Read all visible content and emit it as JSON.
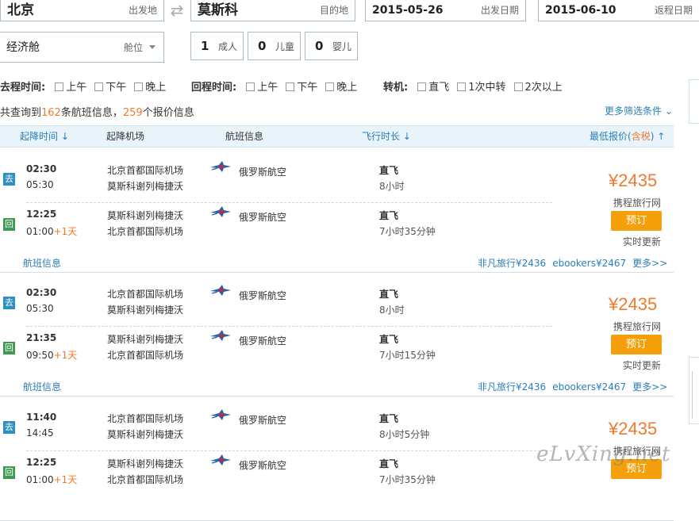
{
  "search": {
    "from_city": "北京",
    "from_hint": "出发地",
    "to_city": "莫斯科",
    "to_hint": "目的地",
    "depart_date": "2015-05-26",
    "depart_hint": "出发日期",
    "return_date": "2015-06-10",
    "return_hint": "返程日期",
    "cabin": "经济舱",
    "cabin_hint": "舱位",
    "adults": "1",
    "adults_label": "成人",
    "children": "0",
    "children_label": "儿童",
    "infants": "0",
    "infants_label": "婴儿"
  },
  "filters": {
    "outbound_label": "去程时间:",
    "outbound_options": [
      "上午",
      "下午",
      "晚上"
    ],
    "return_label": "回程时间:",
    "return_options": [
      "上午",
      "下午",
      "晚上"
    ],
    "transfer_label": "转机:",
    "transfer_options": [
      "直飞",
      "1次中转",
      "2次以上"
    ]
  },
  "summary": {
    "prefix": "共查询到",
    "flights": "162",
    "mid": "条航班信息，",
    "quotes": "259",
    "suffix": "个报价信息",
    "more_filters": "更多筛选条件 ⌄"
  },
  "columns": {
    "time": "起降时间 ↓",
    "airport": "起降机场",
    "flight": "航班信息",
    "duration": "飞行时长 ↓",
    "price_prefix": "最低报价(",
    "price_tax": "含税",
    "price_suffix": ") ↑"
  },
  "results": [
    {
      "legs": [
        {
          "tag": "去",
          "dep": "02:30",
          "arr": "05:30",
          "plus": "",
          "from": "北京首都国际机场",
          "to": "莫斯科谢列梅捷沃",
          "airline": "俄罗斯航空",
          "stop": "直飞",
          "duration": "8小时"
        },
        {
          "tag": "回",
          "dep": "12:25",
          "arr": "01:00",
          "plus": "+1天",
          "from": "莫斯科谢列梅捷沃",
          "to": "北京首都国际机场",
          "airline": "俄罗斯航空",
          "stop": "直飞",
          "duration": "7小时35分钟"
        }
      ],
      "price": "¥2435",
      "vendor": "携程旅行网",
      "book": "预订",
      "realtime": "实时更新",
      "info": "航班信息",
      "others": [
        "非凡旅行¥2436",
        "ebookers¥2467",
        "更多>>"
      ]
    },
    {
      "legs": [
        {
          "tag": "去",
          "dep": "02:30",
          "arr": "05:30",
          "plus": "",
          "from": "北京首都国际机场",
          "to": "莫斯科谢列梅捷沃",
          "airline": "俄罗斯航空",
          "stop": "直飞",
          "duration": "8小时"
        },
        {
          "tag": "回",
          "dep": "21:35",
          "arr": "09:50",
          "plus": "+1天",
          "from": "莫斯科谢列梅捷沃",
          "to": "北京首都国际机场",
          "airline": "俄罗斯航空",
          "stop": "直飞",
          "duration": "7小时15分钟"
        }
      ],
      "price": "¥2435",
      "vendor": "携程旅行网",
      "book": "预订",
      "realtime": "实时更新",
      "info": "航班信息",
      "others": [
        "非凡旅行¥2436",
        "ebookers¥2467",
        "更多>>"
      ]
    },
    {
      "legs": [
        {
          "tag": "去",
          "dep": "11:40",
          "arr": "14:45",
          "plus": "",
          "from": "北京首都国际机场",
          "to": "莫斯科谢列梅捷沃",
          "airline": "俄罗斯航空",
          "stop": "直飞",
          "duration": "8小时5分钟"
        },
        {
          "tag": "回",
          "dep": "12:25",
          "arr": "01:00",
          "plus": "+1天",
          "from": "莫斯科谢列梅捷沃",
          "to": "北京首都国际机场",
          "airline": "俄罗斯航空",
          "stop": "直飞",
          "duration": "7小时35分钟"
        }
      ],
      "price": "¥2435",
      "vendor": "携程旅行网",
      "book": "预订",
      "realtime": "",
      "info": "",
      "others": []
    }
  ],
  "watermark": "eLvXing.net",
  "colors": {
    "accent": "#2a7fb8",
    "price": "#f07b2c",
    "book": "#f5a00a",
    "go_tag": "#2b8fbf",
    "back_tag": "#3e9a50"
  }
}
